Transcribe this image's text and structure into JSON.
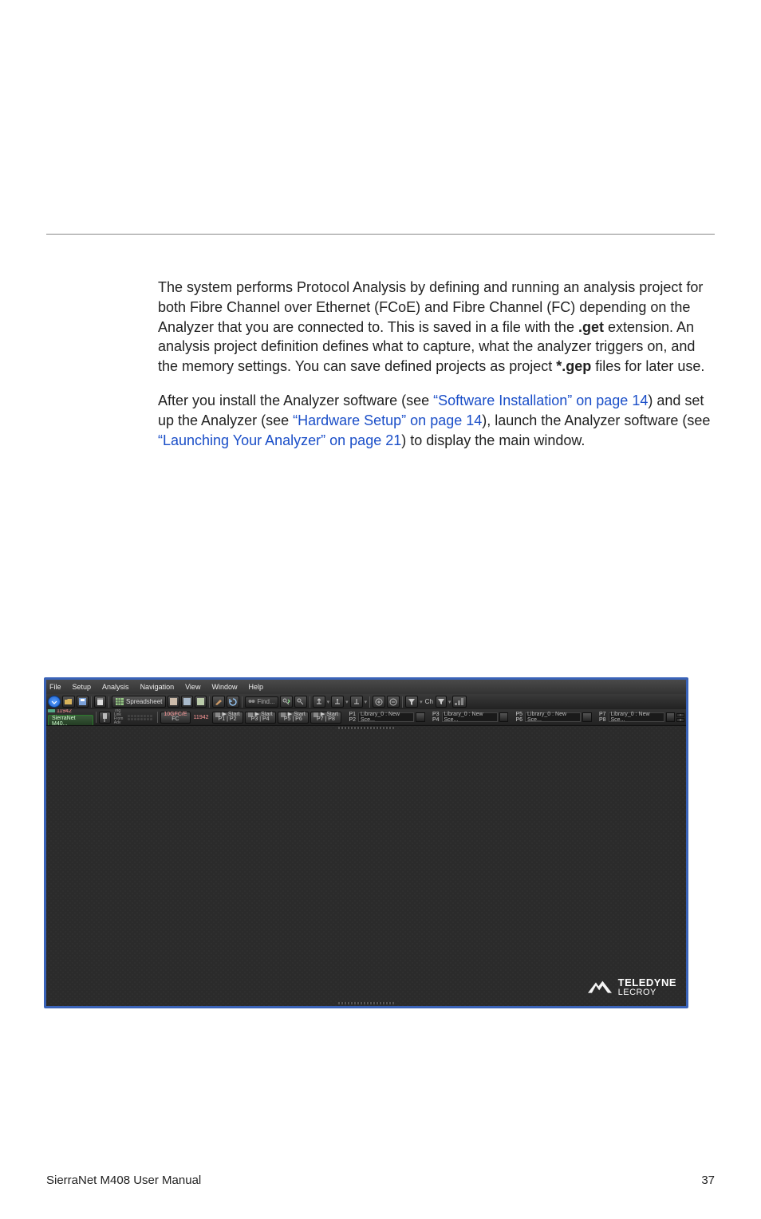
{
  "doc": {
    "footer_left": "SierraNet M408 User Manual",
    "footer_right": "37",
    "p1_a": "The system performs Protocol Analysis by defining and running an analysis project for both Fibre Channel over Ethernet (FCoE) and Fibre Channel (FC) depending on the Analyzer that you are connected to. This is saved in a file with the ",
    "p1_b_bold": ".get",
    "p1_c": " extension. An analysis project definition defines what to capture, what the analyzer triggers on, and the memory settings. You can save defined projects as project ",
    "p1_d_bold": "*.gep",
    "p1_e": " files for later use.",
    "p2_a": "After you install the Analyzer software (see ",
    "p2_link1": "“Software Installation” on page 14",
    "p2_b": ") and set up the Analyzer (see ",
    "p2_link2": "“Hardware Setup” on page 14",
    "p2_c": "), launch the Analyzer software (see ",
    "p2_link3": "“Launching Your Analyzer” on page 21",
    "p2_d": ") to display the main window."
  },
  "app": {
    "menus": [
      "File",
      "Setup",
      "Analysis",
      "Navigation",
      "View",
      "Window",
      "Help"
    ],
    "spreadsheet_label": "Spreadsheet",
    "find_label": "Find...",
    "ch_label": "Ch",
    "filter_label": "▼",
    "device_id": "11942",
    "device_name": "SierraNet M40...",
    "trig_lines": [
      "Trig",
      "Link",
      "From",
      "Adv"
    ],
    "fc_label": "10GFC/E",
    "fc_sub": "FC",
    "fc_id": "11942",
    "start_btns": [
      {
        "line1": "▶ Start",
        "line2": "P1 | P2"
      },
      {
        "line1": "▶ Start",
        "line2": "P3 | P4"
      },
      {
        "line1": "▶ Start",
        "line2": "P5 | P6"
      },
      {
        "line1": "▶ Start",
        "line2": "P7 | P8"
      }
    ],
    "port_groups": [
      {
        "p_top": "P1",
        "p_bot": "P2",
        "lib": "Library_0 : New Sce..."
      },
      {
        "p_top": "P3",
        "p_bot": "P4",
        "lib": "Library_0 : New Sce..."
      },
      {
        "p_top": "P5",
        "p_bot": "P6",
        "lib": "Library_0 : New Sce..."
      },
      {
        "p_top": "P7",
        "p_bot": "P8",
        "lib": "Library_0 : New Sce..."
      }
    ],
    "brand_top": "TELEDYNE",
    "brand_bot": "LECROY"
  }
}
